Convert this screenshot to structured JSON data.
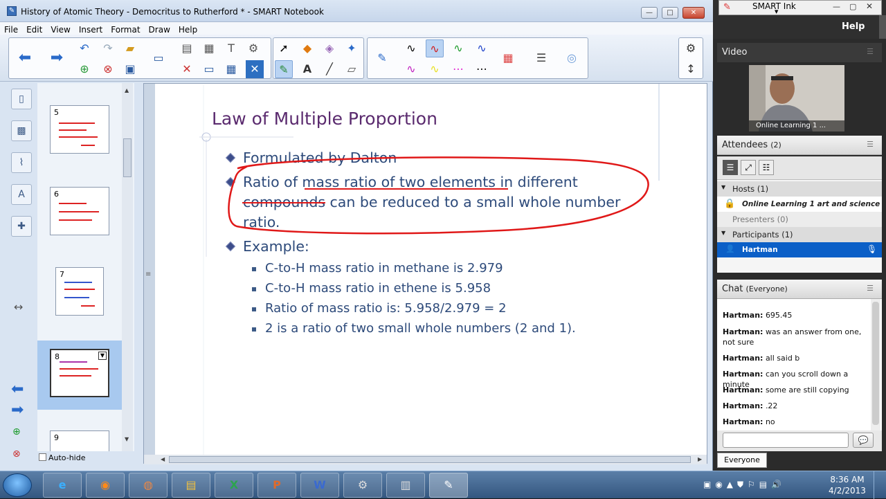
{
  "window": {
    "title": "History of Atomic Theory  - Democritus to Rutherford * - SMART Notebook",
    "min": "—",
    "max": "□",
    "close": "✕"
  },
  "menu": [
    "File",
    "Edit",
    "View",
    "Insert",
    "Format",
    "Draw",
    "Help"
  ],
  "sorter": {
    "pages": [
      "5",
      "6",
      "7",
      "8",
      "9"
    ],
    "autohide_label": "Auto-hide"
  },
  "slide": {
    "title": "Law of Multiple Proportion",
    "bullets": [
      "Formulated by Dalton",
      "Ratio of mass ratio of two elements in different",
      "compounds can be reduced to a small whole number",
      "ratio.",
      "Example:"
    ],
    "subbullets": [
      "C-to-H mass ratio in methane is 2.979",
      "C-to-H mass ratio in ethene is 5.958",
      "Ratio of mass ratio is: 5.958/2.979 = 2",
      "2 is a ratio of two small whole numbers (2 and 1)."
    ]
  },
  "right": {
    "smart_ink": "SMART Ink",
    "help": "Help",
    "video_title": "Video",
    "video_caption": "Online Learning 1 ...",
    "attendees_title": "Attendees",
    "attendees_count": "(2)",
    "hosts": "Hosts (1)",
    "host_name": "Online Learning 1 art and science",
    "presenters": "Presenters (0)",
    "participants": "Participants (1)",
    "participant_name": "Hartman",
    "chat_title": "Chat",
    "chat_scope": "(Everyone)",
    "chat_target": "Everyone",
    "messages": [
      {
        "from": "Hartman:",
        "text": "695.45"
      },
      {
        "from": "Hartman:",
        "text": "was an answer from one, not sure"
      },
      {
        "from": "Hartman:",
        "text": "all said b"
      },
      {
        "from": "Hartman:",
        "text": "can you scroll down a minute"
      },
      {
        "from": "Hartman:",
        "text": "some are still copying"
      },
      {
        "from": "Hartman:",
        "text": ".22"
      },
      {
        "from": "Hartman:",
        "text": "no"
      }
    ]
  },
  "taskbar": {
    "time": "8:36 AM",
    "date": "4/2/2013"
  },
  "colors": {
    "title_purple": "#5a2a6e",
    "body_blue": "#2d4a7a",
    "ink_red": "#e01818",
    "selected_blue": "#0b5fc7"
  }
}
